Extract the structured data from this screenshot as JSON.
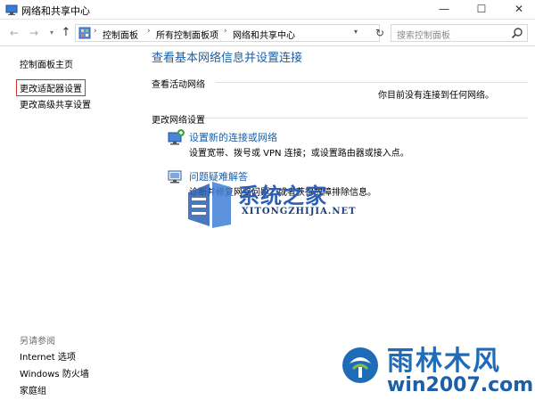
{
  "window": {
    "title": "网络和共享中心",
    "min_glyph": "—",
    "max_glyph": "☐",
    "close_glyph": "✕"
  },
  "nav": {
    "back_glyph": "←",
    "forward_glyph": "→",
    "dropdown_glyph": "▾",
    "up_glyph": "↑",
    "refresh_glyph": "↻"
  },
  "address": {
    "breadcrumbs": [
      "控制面板",
      "所有控制面板项",
      "网络和共享中心"
    ],
    "separator": "›",
    "dropdown_glyph": "▾"
  },
  "search": {
    "placeholder": "搜索控制面板"
  },
  "sidebar": {
    "links": [
      "控制面板主页",
      "更改适配器设置",
      "更改高级共享设置"
    ],
    "see_also_label": "另请参阅",
    "see_also": [
      "Internet 选项",
      "Windows 防火墙",
      "家庭组"
    ]
  },
  "main": {
    "title": "查看基本网络信息并设置连接",
    "active_networks_label": "查看活动网络",
    "no_network_text": "你目前没有连接到任何网络。",
    "change_settings_label": "更改网络设置",
    "tasks": [
      {
        "link": "设置新的连接或网络",
        "desc": "设置宽带、拨号或 VPN 连接；或设置路由器或接入点。"
      },
      {
        "link": "问题疑难解答",
        "desc": "诊断并修复网络问题，或者获得故障排除信息。"
      }
    ]
  },
  "watermarks": {
    "site1_name": "系统之家",
    "site1_url": "XITONGZHIJIA.NET",
    "site2_name": "雨林木风",
    "site2_url": "win2007.com"
  },
  "colors": {
    "link_blue": "#1a5fa8",
    "active_border": "#d32f2f"
  }
}
